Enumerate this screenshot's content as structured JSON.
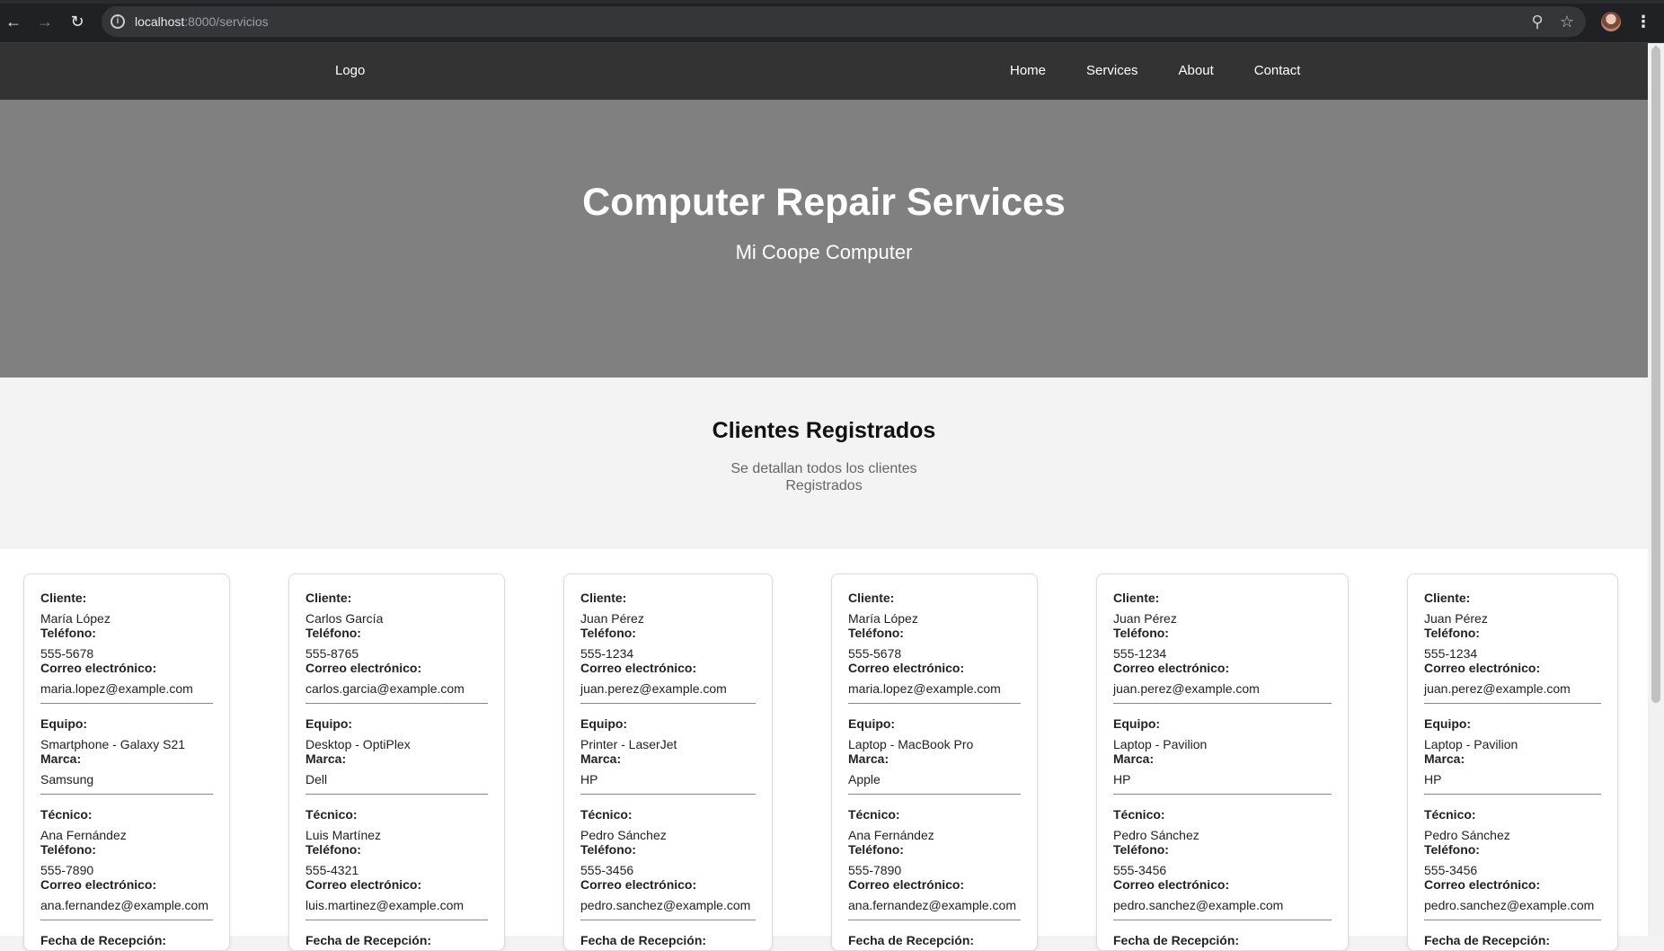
{
  "browser": {
    "url_host": "localhost",
    "url_path": ":8000/servicios",
    "icons": [
      "back-arrow-icon",
      "forward-arrow-icon",
      "reload-icon",
      "info-icon",
      "zoom-icon",
      "star-icon",
      "profile-avatar",
      "kebab-menu-icon"
    ]
  },
  "header": {
    "logo_alt": "Logo",
    "nav": [
      "Home",
      "Services",
      "About",
      "Contact"
    ]
  },
  "hero": {
    "title": "Computer Repair Services",
    "subtitle": "Mi Coope Computer"
  },
  "section": {
    "title": "Clientes Registrados",
    "description": "Se detallan todos los clientes Registrados"
  },
  "labels": {
    "cliente": "Cliente:",
    "telefono": "Teléfono:",
    "correo": "Correo electrónico:",
    "equipo": "Equipo:",
    "marca": "Marca:",
    "tecnico": "Técnico:",
    "fecha": "Fecha de Recepción:"
  },
  "cards": [
    {
      "cliente": "María López",
      "telefono": "555-5678",
      "correo": "maria.lopez@example.com",
      "equipo": "Smartphone - Galaxy S21",
      "marca": "Samsung",
      "tecnico": "Ana Fernández",
      "tec_telefono": "555-7890",
      "tec_correo": "ana.fernandez@example.com"
    },
    {
      "cliente": "Carlos García",
      "telefono": "555-8765",
      "correo": "carlos.garcia@example.com",
      "equipo": "Desktop - OptiPlex",
      "marca": "Dell",
      "tecnico": "Luis Martínez",
      "tec_telefono": "555-4321",
      "tec_correo": "luis.martinez@example.com"
    },
    {
      "cliente": "Juan Pérez",
      "telefono": "555-1234",
      "correo": "juan.perez@example.com",
      "equipo": "Printer - LaserJet",
      "marca": "HP",
      "tecnico": "Pedro Sánchez",
      "tec_telefono": "555-3456",
      "tec_correo": "pedro.sanchez@example.com"
    },
    {
      "cliente": "María López",
      "telefono": "555-5678",
      "correo": "maria.lopez@example.com",
      "equipo": "Laptop - MacBook Pro",
      "marca": "Apple",
      "tecnico": "Ana Fernández",
      "tec_telefono": "555-7890",
      "tec_correo": "ana.fernandez@example.com"
    },
    {
      "cliente": "Juan Pérez",
      "telefono": "555-1234",
      "correo": "juan.perez@example.com",
      "equipo": "Laptop - Pavilion",
      "marca": "HP",
      "tecnico": "Pedro Sánchez",
      "tec_telefono": "555-3456",
      "tec_correo": "pedro.sanchez@example.com"
    },
    {
      "cliente": "Juan Pérez",
      "telefono": "555-1234",
      "correo": "juan.perez@example.com",
      "equipo": "Laptop - Pavilion",
      "marca": "HP",
      "tecnico": "Pedro Sánchez",
      "tec_telefono": "555-3456",
      "tec_correo": "pedro.sanchez@example.com"
    }
  ]
}
